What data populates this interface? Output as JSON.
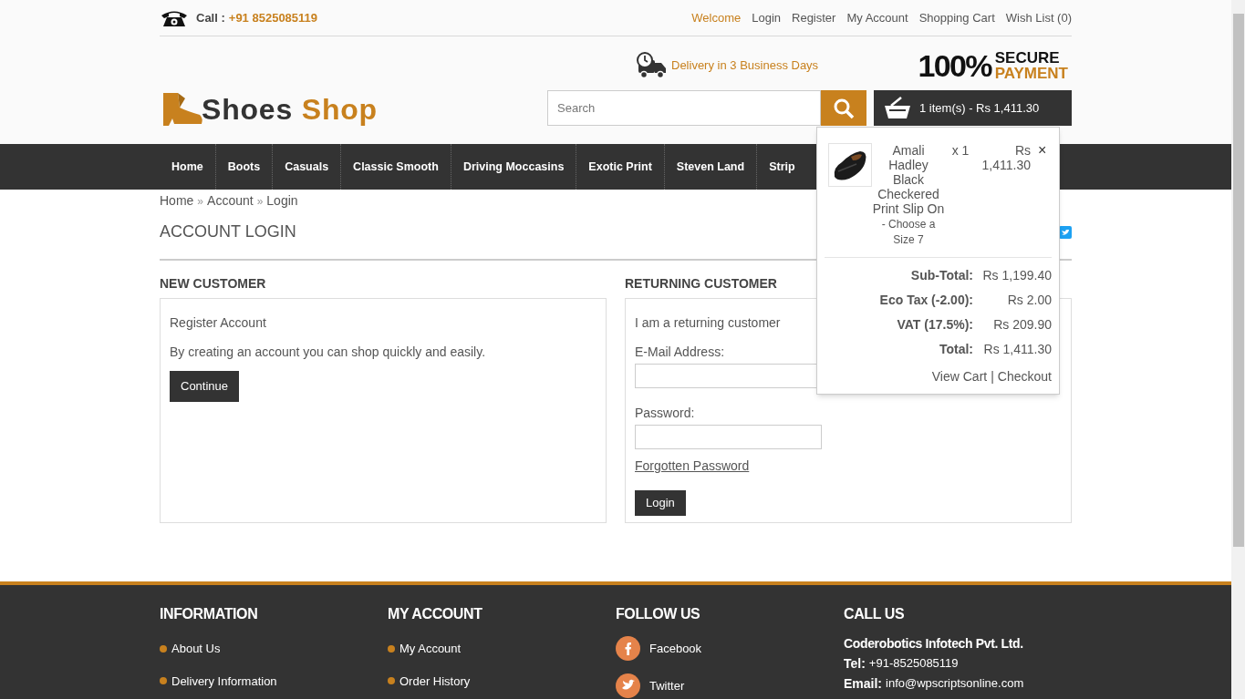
{
  "topbar": {
    "call_label": "Call :",
    "phone": "+91 8525085119",
    "links": [
      {
        "label": "Welcome",
        "selected": true
      },
      {
        "label": "Login",
        "selected": false
      },
      {
        "label": "Register",
        "selected": false
      },
      {
        "label": "My Account",
        "selected": false
      },
      {
        "label": "Shopping Cart",
        "selected": false
      },
      {
        "label": "Wish List (0)",
        "selected": false
      }
    ]
  },
  "header": {
    "logo": [
      "Shoes",
      "Shop"
    ],
    "delivery": "Delivery in 3 Business Days",
    "secure": {
      "big": "100%",
      "line1": "SECURE",
      "line2": "PAYMENT"
    },
    "search": {
      "placeholder": "Search"
    },
    "cart_button": "1 item(s) - Rs 1,411.30"
  },
  "cart_dropdown": {
    "item": {
      "name": "Amali Hadley Black Checkered Print Slip On",
      "option": "- Choose a Size 7",
      "qty": "x 1",
      "price": "Rs 1,411.30",
      "remove": "×"
    },
    "totals": [
      {
        "label": "Sub-Total:",
        "value": "Rs 1,199.40"
      },
      {
        "label": "Eco Tax (-2.00):",
        "value": "Rs 2.00"
      },
      {
        "label": "VAT (17.5%):",
        "value": "Rs 209.90"
      },
      {
        "label": "Total:",
        "value": "Rs 1,411.30"
      }
    ],
    "links": [
      "View Cart",
      "Checkout"
    ],
    "separator": "|"
  },
  "nav": [
    "Home",
    "Boots",
    "Casuals",
    "Classic Smooth",
    "Driving Moccasins",
    "Exotic Print",
    "Steven Land",
    "Strip"
  ],
  "breadcrumb": {
    "items": [
      "Home",
      "Account",
      "Login"
    ],
    "separator": "»"
  },
  "page_title": "ACCOUNT LOGIN",
  "new_customer": {
    "heading": "NEW CUSTOMER",
    "title": "Register Account",
    "text": "By creating an account you can shop quickly and easily.",
    "button": "Continue"
  },
  "returning_customer": {
    "heading": "RETURNING CUSTOMER",
    "intro": "I am a returning customer",
    "email_label": "E-Mail Address:",
    "password_label": "Password:",
    "forgotten": "Forgotten Password",
    "button": "Login"
  },
  "footer": {
    "columns": [
      {
        "kind": "links",
        "heading": "INFORMATION",
        "items": [
          "About Us",
          "Delivery Information"
        ]
      },
      {
        "kind": "links",
        "heading": "MY ACCOUNT",
        "items": [
          "My Account",
          "Order History"
        ]
      },
      {
        "kind": "social",
        "heading": "FOLLOW US",
        "items": [
          "Facebook",
          "Twitter"
        ]
      },
      {
        "kind": "contact",
        "heading": "CALL US",
        "company": "Coderobotics Infotech Pvt. Ltd.",
        "lines": [
          {
            "label": "Tel:",
            "value": "+91-8525085119"
          },
          {
            "label": "Email:",
            "value": "info@wpscriptsonline.com"
          }
        ]
      }
    ]
  }
}
